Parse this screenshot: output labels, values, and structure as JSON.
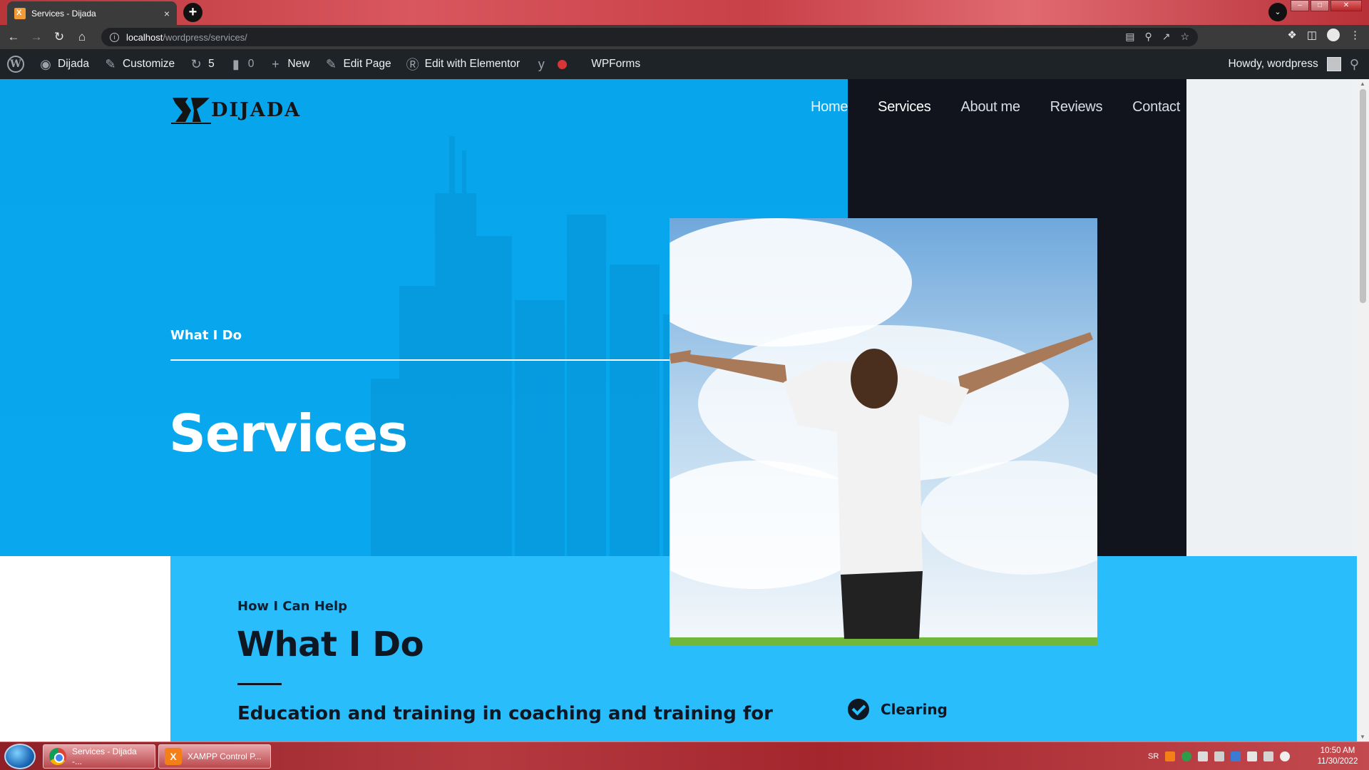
{
  "browser": {
    "tab_title": "Services - Dijada",
    "tab_close": "×",
    "new_tab": "+",
    "tab_search": "⌄",
    "window_controls": {
      "minimize": "–",
      "maximize": "□",
      "close": "✕"
    }
  },
  "address_bar": {
    "url_host": "localhost",
    "url_path": "/wordpress/services/"
  },
  "admin_bar": {
    "site_name": "Dijada",
    "customize": "Customize",
    "updates_count": "5",
    "comments_count": "0",
    "new": "New",
    "edit_page": "Edit Page",
    "edit_elementor": "Edit with Elementor",
    "yoast": "y",
    "wpforms": "WPForms",
    "howdy": "Howdy, wordpress"
  },
  "site": {
    "logo_text": "DIJADA",
    "nav": [
      "Home",
      "Services",
      "About me",
      "Reviews",
      "Contact"
    ],
    "active_nav": "Services",
    "hero_eyebrow": "What I Do",
    "hero_title": "Services",
    "section_eyebrow": "How I Can Help",
    "section_title": "What I Do",
    "section_text": "Education and training in coaching and training for",
    "checklist": [
      "Clearing"
    ]
  },
  "taskbar": {
    "chrome_window": "Services - Dijada -...",
    "xampp_window": "XAMPP Control P...",
    "language": "SR",
    "time": "10:50 AM",
    "date": "11/30/2022"
  },
  "colors": {
    "hero_blue": "#08a7ee",
    "section_blue": "#29bdfb",
    "dark_panel": "#11141c",
    "wp_bar": "#1d2327"
  }
}
